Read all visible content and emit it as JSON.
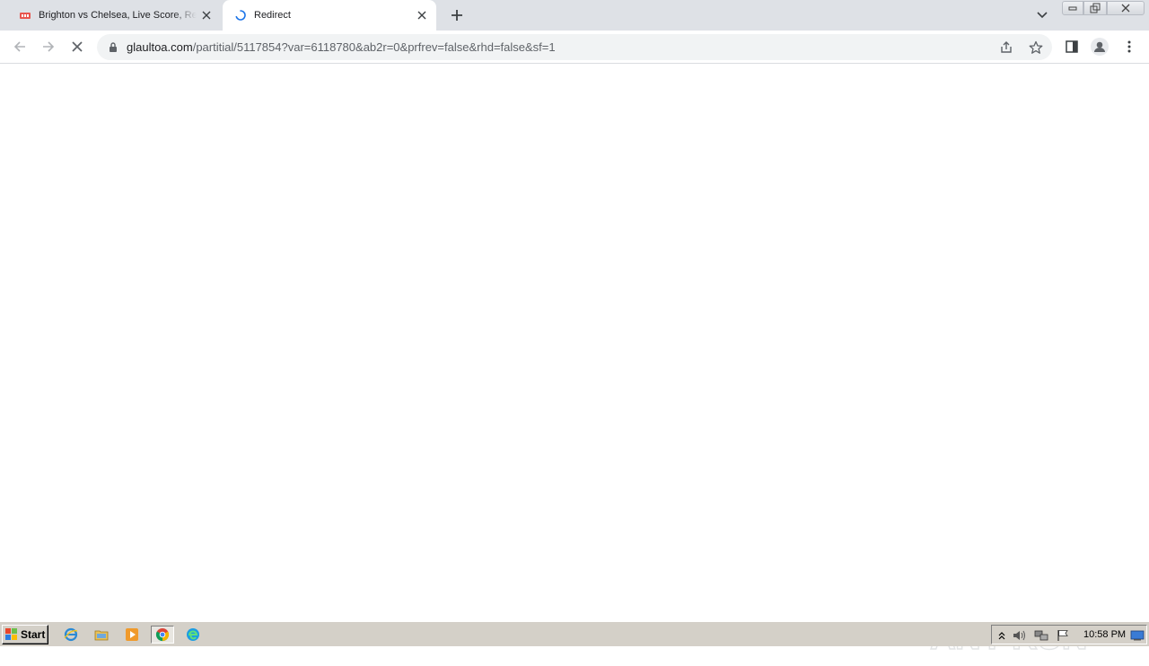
{
  "tabs": [
    {
      "title": "Brighton vs Chelsea, Live Score, Res",
      "favicon": "livescore-favicon",
      "loading": false
    },
    {
      "title": "Redirect",
      "favicon": "loading-spinner-icon",
      "loading": true
    }
  ],
  "address_bar": {
    "host": "glaultoa.com",
    "path": "/partitial/5117854?var=6118780&ab2r=0&prfrev=false&rhd=false&sf=1"
  },
  "watermark": {
    "text": "ANY RUN"
  },
  "taskbar": {
    "start_label": "Start",
    "clock": "10:58 PM"
  },
  "colors": {
    "tabstrip": "#dee1e6",
    "omnibox": "#f1f3f4",
    "taskbar": "#d4d0c8",
    "spinner": "#1a73e8"
  }
}
